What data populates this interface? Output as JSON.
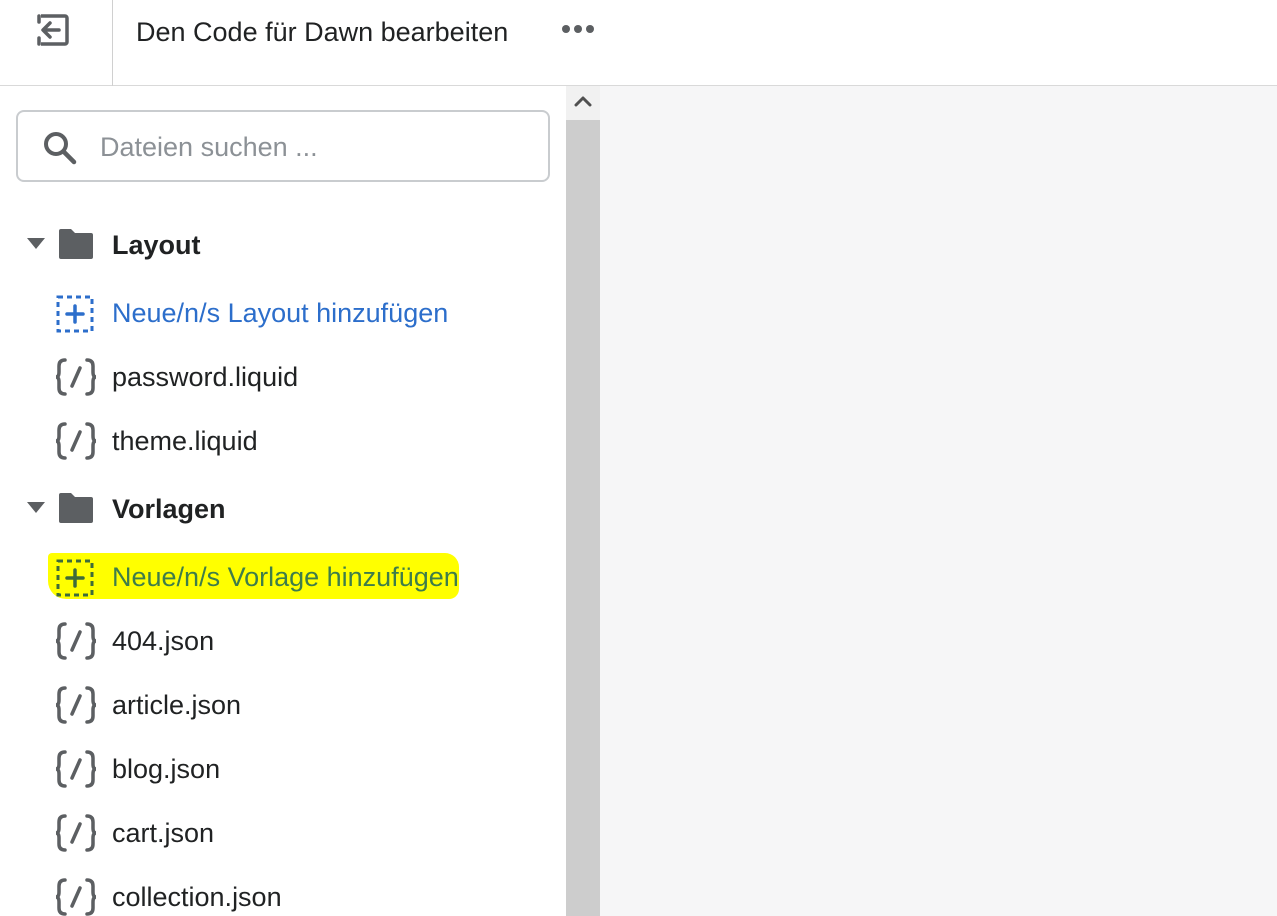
{
  "header": {
    "exit_icon": "exit-arrow-icon",
    "title": "Den Code für Dawn bearbeiten",
    "more_icon": "more-horizontal-icon"
  },
  "search": {
    "placeholder": "Dateien suchen ...",
    "value": "",
    "icon": "search-icon"
  },
  "tree": {
    "layout": {
      "label": "Layout",
      "expanded": true,
      "add_label": "Neue/n/s Layout hinzufügen",
      "files": [
        "password.liquid",
        "theme.liquid"
      ]
    },
    "templates": {
      "label": "Vorlagen",
      "expanded": true,
      "add_label": "Neue/n/s Vorlage hinzufügen",
      "files": [
        "404.json",
        "article.json",
        "blog.json",
        "cart.json",
        "collection.json"
      ]
    }
  },
  "colors": {
    "link_blue": "#2c6ecb",
    "highlight_yellow": "#ffff00",
    "icon_gray": "#5c5f62",
    "editor_bg": "#f6f6f7"
  }
}
